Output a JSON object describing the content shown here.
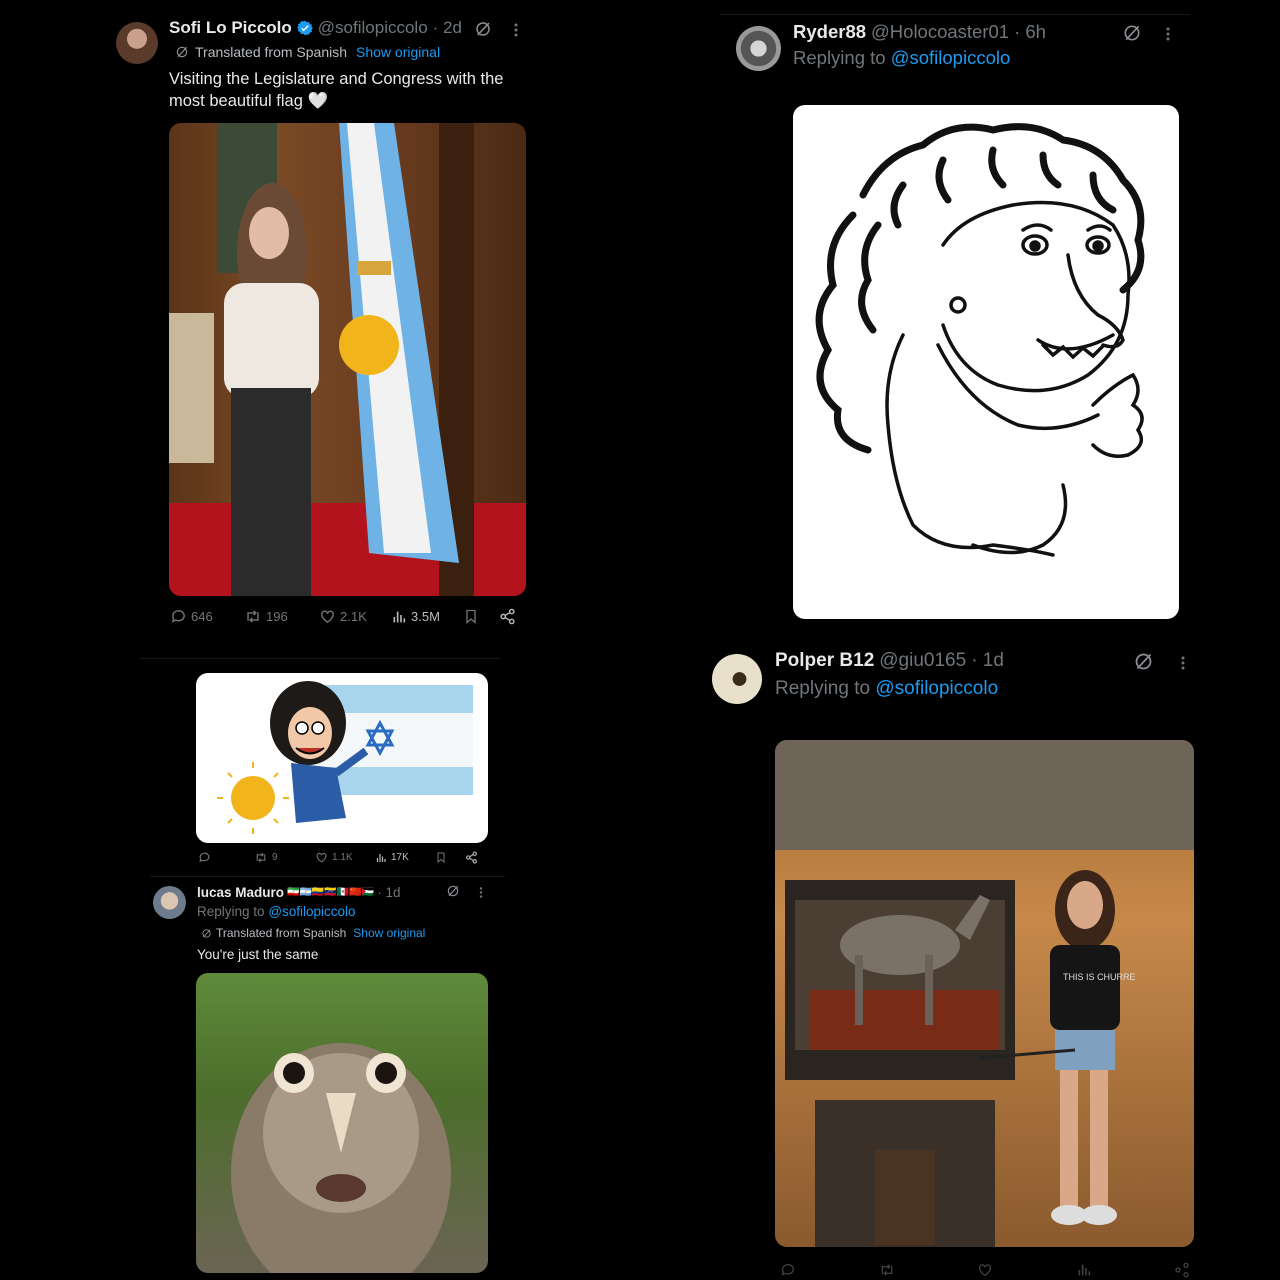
{
  "post1": {
    "display_name": "Sofi Lo Piccolo",
    "handle": "@sofilopiccolo",
    "time": "· 2d",
    "translated": "Translated from Spanish",
    "show_original": "Show original",
    "text": "Visiting the Legislature and Congress with the most beautiful flag 🤍",
    "stats": {
      "replies": "646",
      "reposts": "196",
      "likes": "2.1K",
      "views": "3.5M"
    }
  },
  "post2": {
    "stats": {
      "reposts": "9",
      "likes": "1.1K",
      "views": "17K"
    }
  },
  "post3": {
    "display_name": "lucas Maduro",
    "flags": "🇮🇷🇦🇷🇨🇴🇻🇪🇲🇽🇨🇳🇵🇸",
    "time": "· 1d",
    "replying_prefix": "Replying to",
    "replying_to": "@sofilopiccolo",
    "translated": "Translated from Spanish",
    "show_original": "Show original",
    "text": "You're just the same"
  },
  "post4": {
    "display_name": "Ryder88",
    "handle": "@Holocoaster01",
    "time": "· 6h",
    "replying_prefix": "Replying to",
    "replying_to": "@sofilopiccolo"
  },
  "post5": {
    "display_name": "Polper B12",
    "handle": "@giu0165",
    "time": "· 1d",
    "replying_prefix": "Replying to",
    "replying_to": "@sofilopiccolo",
    "image_text": "THIS IS CHURRE"
  },
  "icons": {
    "verified": "verified-badge-icon",
    "grok": "grok-icon",
    "more": "more-icon",
    "reply": "reply-icon",
    "repost": "repost-icon",
    "like": "like-icon",
    "views": "views-icon",
    "bookmark": "bookmark-icon",
    "share": "share-icon",
    "translate": "translate-icon"
  },
  "colors": {
    "background": "#000000",
    "text": "#e7e9ea",
    "muted": "#71767b",
    "link": "#1d9bf0",
    "verified": "#1d9bf0"
  }
}
